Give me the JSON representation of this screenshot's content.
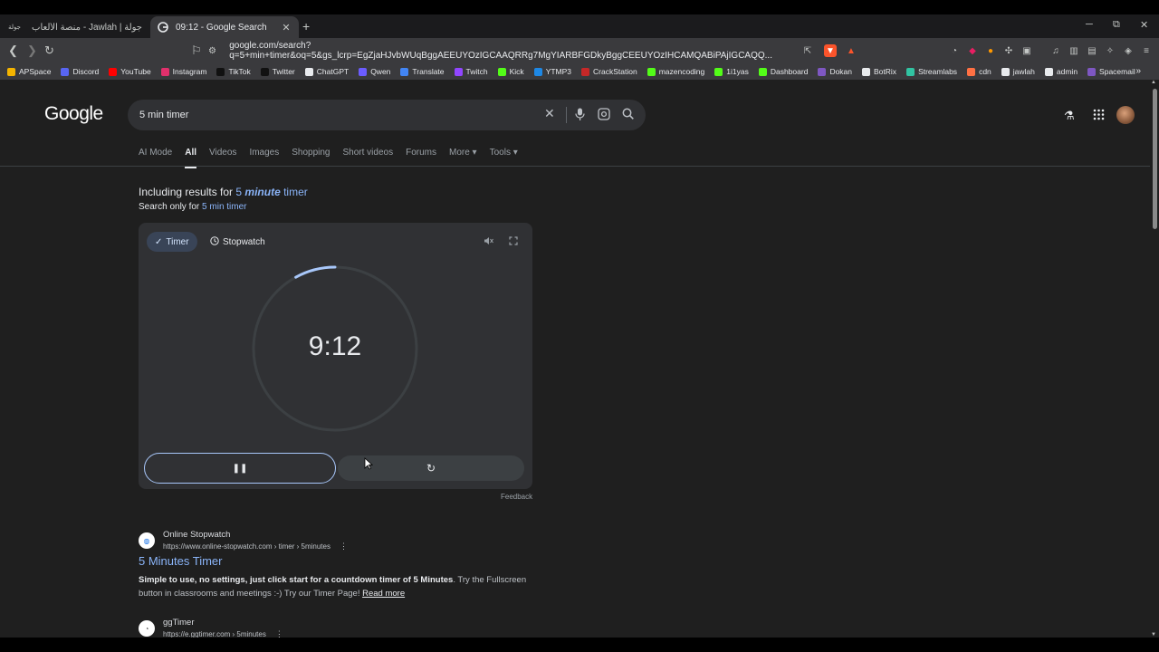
{
  "browser": {
    "tabs": [
      {
        "title": "جولة | Jawlah - منصة الألعاب التفاعلية",
        "favicon": "جولة",
        "active": false
      },
      {
        "title": "09:12 - Google Search",
        "favicon": "G",
        "active": true
      }
    ],
    "new_tab": "+",
    "window_controls": {
      "minimize": "─",
      "maximize": "⧉",
      "close": "✕"
    },
    "url": "google.com/search?q=5+min+timer&oq=5&gs_lcrp=EgZjaHJvbWUqBggAEEUYOzIGCAAQRRg7MgYIARBFGDkyBggCEEUYOzIHCAMQABiPAjIGCAQQ...",
    "bookmarks": [
      {
        "label": "APSpace",
        "color": "#f4b400"
      },
      {
        "label": "Discord",
        "color": "#5865f2"
      },
      {
        "label": "YouTube",
        "color": "#ff0000"
      },
      {
        "label": "Instagram",
        "color": "#e1306c"
      },
      {
        "label": "TikTok",
        "color": "#111111"
      },
      {
        "label": "Twitter",
        "color": "#111111"
      },
      {
        "label": "ChatGPT",
        "color": "#e8eaed"
      },
      {
        "label": "Qwen",
        "color": "#6b5cff"
      },
      {
        "label": "Translate",
        "color": "#4285f4"
      },
      {
        "label": "Twitch",
        "color": "#9146ff"
      },
      {
        "label": "Kick",
        "color": "#53fc18"
      },
      {
        "label": "YTMP3",
        "color": "#1e88e5"
      },
      {
        "label": "CrackStation",
        "color": "#c62828"
      },
      {
        "label": "mazencoding",
        "color": "#53fc18"
      },
      {
        "label": "1i1yas",
        "color": "#53fc18"
      },
      {
        "label": "Dashboard",
        "color": "#53fc18"
      },
      {
        "label": "Dokan",
        "color": "#7e57c2"
      },
      {
        "label": "BotRix",
        "color": "#e8eaed"
      },
      {
        "label": "Streamlabs",
        "color": "#31c3a2"
      },
      {
        "label": "cdn",
        "color": "#ff7043"
      },
      {
        "label": "jawlah",
        "color": "#e8eaed"
      },
      {
        "label": "admin",
        "color": "#e8eaed"
      },
      {
        "label": "Spacemail",
        "color": "#7e57c2"
      }
    ],
    "bookmarks_more": "»"
  },
  "google": {
    "logo": "Google",
    "query": "5 min timer",
    "nav_tabs": [
      "AI Mode",
      "All",
      "Videos",
      "Images",
      "Shopping",
      "Short videos",
      "Forums",
      "More ▾",
      "Tools ▾"
    ],
    "including_prefix": "Including results for ",
    "including_q1": "5 ",
    "including_q2": "minute",
    "including_q3": " timer",
    "search_only_prefix": "Search only for ",
    "search_only_link": "5 min timer"
  },
  "timer": {
    "tab_timer": "Timer",
    "tab_stopwatch": "Stopwatch",
    "time": "9:12",
    "progress_fraction": 0.08,
    "pause_label": "❚❚",
    "reset_label": "↻",
    "feedback": "Feedback"
  },
  "results": [
    {
      "site": "Online Stopwatch",
      "url": "https://www.online-stopwatch.com › timer › 5minutes",
      "title": "5 Minutes Timer",
      "snippet_bold": "Simple to use, no settings, just click start for a countdown timer of 5 Minutes",
      "snippet_rest": ". Try the Fullscreen button in classrooms and meetings :-) Try our Timer Page! ",
      "read_more": "Read more"
    },
    {
      "site": "ggTimer",
      "url": "https://e.ggtimer.com › 5minutes"
    }
  ],
  "colors": {
    "accent": "#8ab4f8",
    "page_bg": "#1f1f1f",
    "card_bg": "#303134"
  }
}
